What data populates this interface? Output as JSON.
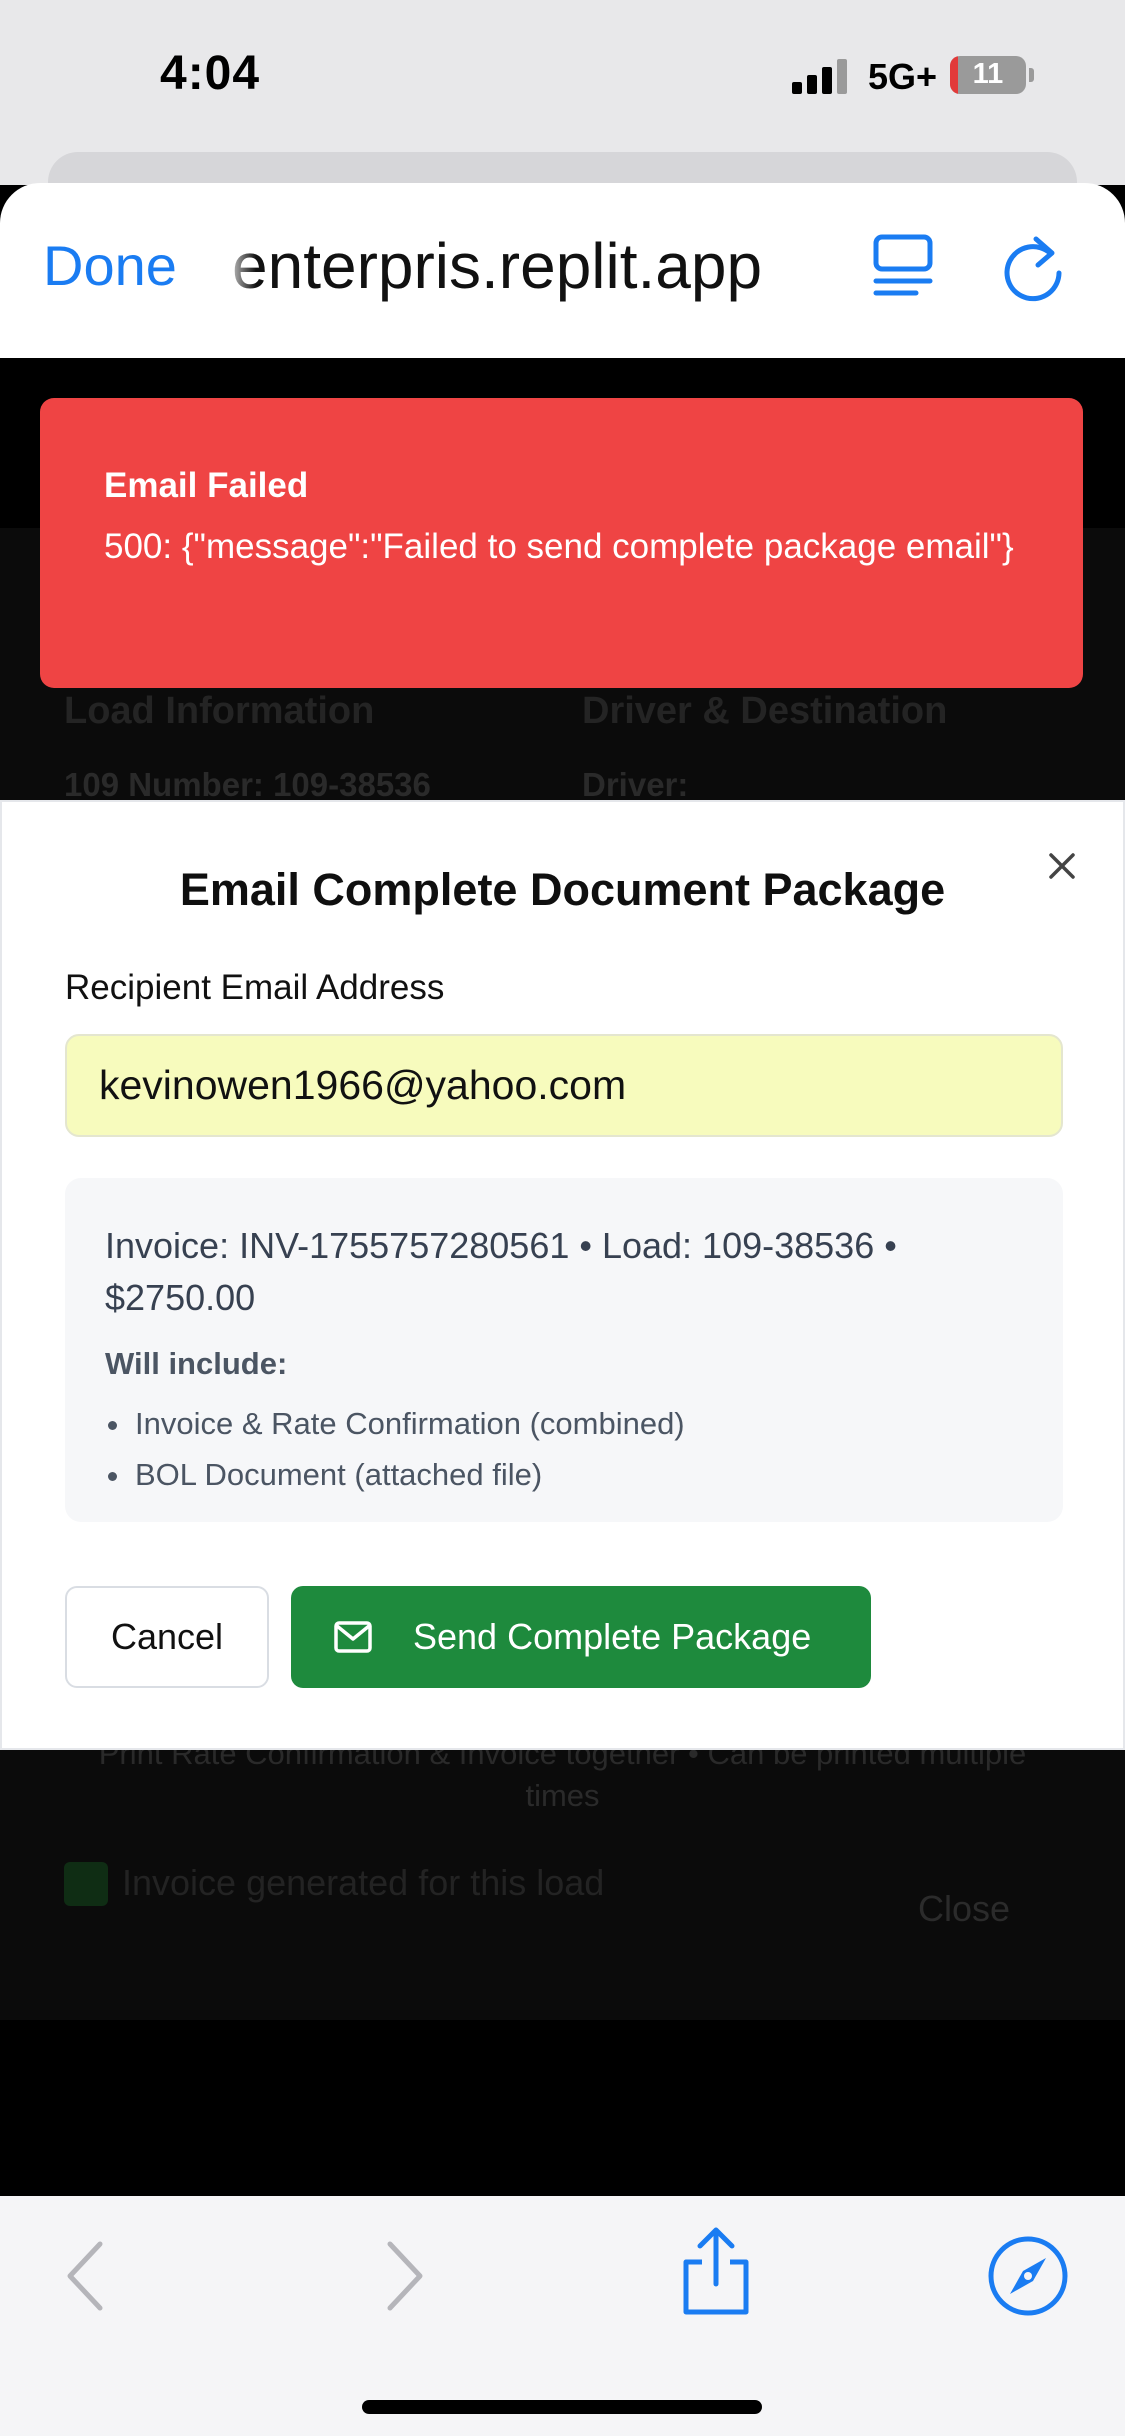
{
  "status_bar": {
    "time": "4:04",
    "network": "5G+",
    "battery": "11",
    "battery_level_percent": 11
  },
  "browser": {
    "done_label": "Done",
    "url": "enterpris.replit.app",
    "accent_color": "#1a7cf2",
    "icons": [
      "reader-icon",
      "reload-icon",
      "back-icon",
      "forward-icon",
      "share-icon",
      "compass-icon"
    ]
  },
  "background_page": {
    "heading_left": "Load Information",
    "heading_right": "Driver & Destination",
    "field_left": "109 Number: 109-38536",
    "field_right": "Driver:",
    "note_line1": "Print Rate Confirmation & Invoice together • Can be printed multiple",
    "note_line2": "times",
    "checkbox_label": "Invoice generated for this load",
    "close_label": "Close"
  },
  "toast": {
    "title": "Email Failed",
    "message": "500: {\"message\":\"Failed to send complete package email\"}",
    "color": "#ef4444"
  },
  "modal": {
    "title": "Email Complete Document Package",
    "email_label": "Recipient Email Address",
    "email_value": "kevinowen1966@yahoo.com",
    "summary": "Invoice: INV-1755757280561 • Load: 109-38536 • $2750.00",
    "include_heading": "Will include:",
    "include_items": [
      "Invoice & Rate Confirmation (combined)",
      "BOL Document (attached file)"
    ],
    "cancel_label": "Cancel",
    "send_label": "Send Complete Package",
    "send_color": "#1e8a3d"
  }
}
